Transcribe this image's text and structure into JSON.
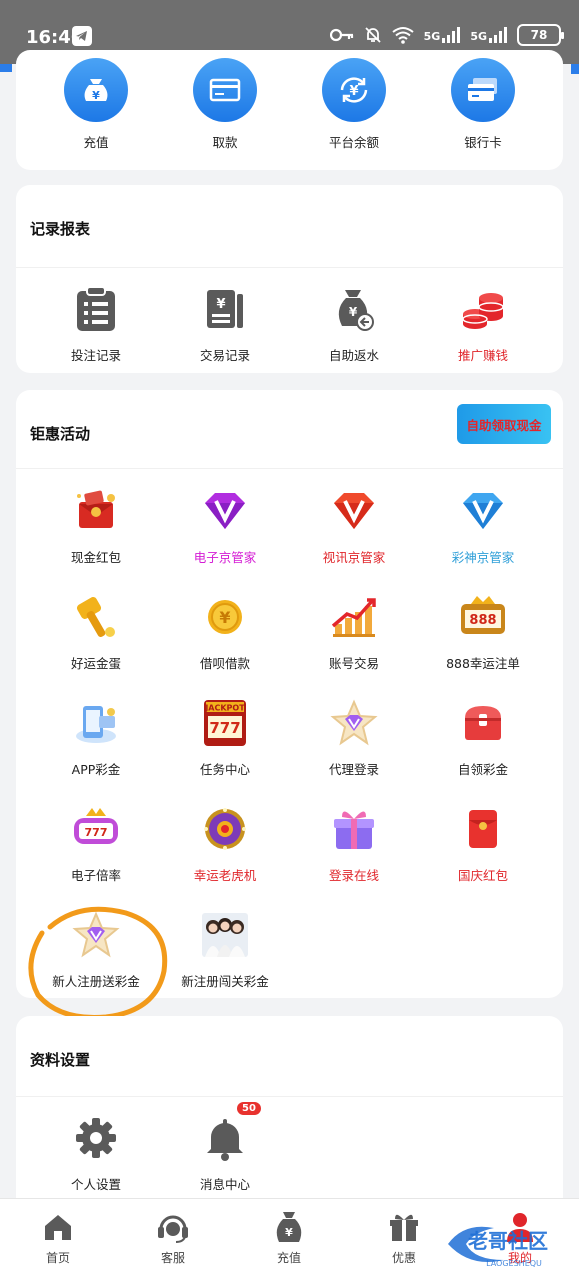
{
  "status_bar": {
    "time": "16:46",
    "battery": "78",
    "sig1": "5G",
    "sig2": "5G"
  },
  "wallet": {
    "items": [
      {
        "label": "充值",
        "icon": "money-bag-icon"
      },
      {
        "label": "取款",
        "icon": "card-withdraw-icon"
      },
      {
        "label": "平台余额",
        "icon": "balance-exchange-icon"
      },
      {
        "label": "银行卡",
        "icon": "bank-card-icon"
      }
    ]
  },
  "records": {
    "title": "记录报表",
    "items": [
      {
        "label": "投注记录",
        "icon": "clipboard-icon"
      },
      {
        "label": "交易记录",
        "icon": "ledger-icon"
      },
      {
        "label": "自助返水",
        "icon": "refund-bag-icon"
      },
      {
        "label": "推广赚钱",
        "icon": "coin-stack-icon"
      }
    ]
  },
  "activities": {
    "title": "钜惠活动",
    "cash_button": "自助领取现金",
    "items": [
      {
        "label": "现金红包",
        "icon": "red-envelope-icon",
        "color": "#e0262b"
      },
      {
        "label": "电子京管家",
        "icon": "purple-diamond-icon",
        "color": "#d41bd4"
      },
      {
        "label": "视讯京管家",
        "icon": "red-diamond-icon",
        "color": "#e0262b"
      },
      {
        "label": "彩神京管家",
        "icon": "blue-diamond-icon",
        "color": "#2f9fd8"
      },
      {
        "label": "好运金蛋",
        "icon": "golden-hammer-icon"
      },
      {
        "label": "借呗借款",
        "icon": "gold-coin-icon"
      },
      {
        "label": "账号交易",
        "icon": "rising-chart-icon"
      },
      {
        "label": "888幸运注单",
        "icon": "slot-888-icon"
      },
      {
        "label": "APP彩金",
        "icon": "app-phone-icon"
      },
      {
        "label": "任务中心",
        "icon": "jackpot-777-icon"
      },
      {
        "label": "代理登录",
        "icon": "star-badge-icon"
      },
      {
        "label": "自领彩金",
        "icon": "treasure-chest-icon"
      },
      {
        "label": "电子倍率",
        "icon": "slot-reels-icon"
      },
      {
        "label": "幸运老虎机",
        "icon": "purple-wheel-icon",
        "color": "#e0262b"
      },
      {
        "label": "登录在线",
        "icon": "gift-box-icon",
        "color": "#e0262b"
      },
      {
        "label": "国庆红包",
        "icon": "red-packet-icon",
        "color": "#e0262b"
      },
      {
        "label": "新人注册送彩金",
        "icon": "star-badge-icon"
      },
      {
        "label": "新注册闯关彩金",
        "icon": "group-photo-icon"
      }
    ]
  },
  "settings": {
    "title": "资料设置",
    "items": [
      {
        "label": "个人设置",
        "icon": "gear-icon"
      },
      {
        "label": "消息中心",
        "icon": "bell-icon",
        "badge": "50"
      }
    ]
  },
  "tabbar": {
    "items": [
      {
        "label": "首页",
        "icon": "home-icon"
      },
      {
        "label": "客服",
        "icon": "headset-icon"
      },
      {
        "label": "充值",
        "icon": "money-bag-icon"
      },
      {
        "label": "优惠",
        "icon": "gift-icon"
      },
      {
        "label": "我的",
        "icon": "user-icon",
        "active": true
      }
    ]
  },
  "watermark": {
    "text": "老哥社区",
    "sub": "LAOGESHEQU"
  }
}
